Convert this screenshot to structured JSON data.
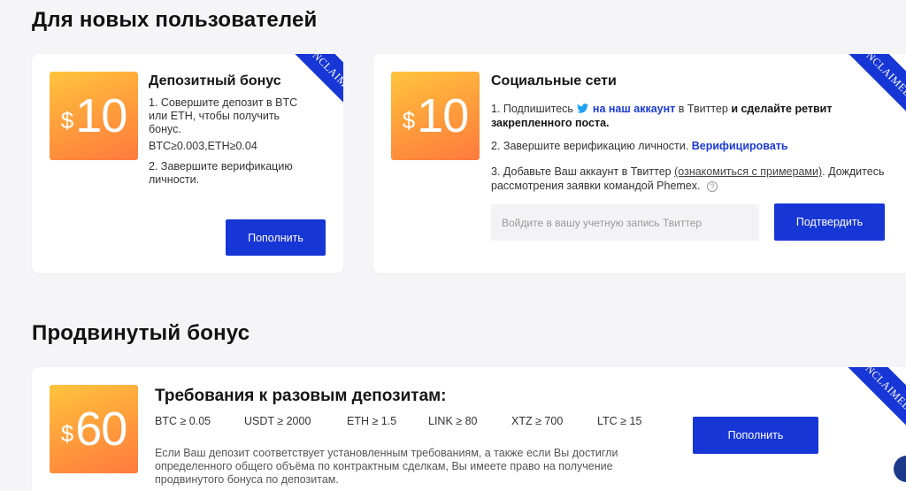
{
  "sections": {
    "new_users_title": "Для новых пользователей",
    "advanced_title": "Продвинутый бонус"
  },
  "ribbon_label": "UNCLAIMED",
  "deposit_card": {
    "badge_dollar": "$",
    "badge_amount": "10",
    "title": "Депозитный бонус",
    "step1": "1. Совершите депозит в BTC или ETH, чтобы получить бонус.",
    "requirement": "BTC≥0.003,ETH≥0.04",
    "step2": "2. Завершите верификацию личности.",
    "button_label": "Пополнить"
  },
  "social_card": {
    "badge_dollar": "$",
    "badge_amount": "10",
    "title": "Социальные сети",
    "step1_prefix": "1. Подпишитесь",
    "step1_link": "на наш аккаунт",
    "step1_mid": "в Твиттер",
    "step1_bold": "и сделайте ретвит закрепленного поста.",
    "step2_prefix": "2. Завершите верификацию личности.",
    "step2_link": "Верифицировать",
    "step3_prefix": "3. Добавьте Ваш аккаунт в Твиттер",
    "step3_link": "(ознакомиться с примерами)",
    "step3_suffix": ". Дождитесь рассмотрения заявки командой Phemex.",
    "input_placeholder": "Войдите в вашу учетную запись Твиттер",
    "button_label": "Подтвердить"
  },
  "advanced_card": {
    "badge_dollar": "$",
    "badge_amount": "60",
    "title": "Требования к разовым депозитам:",
    "requirements": [
      "BTC ≥ 0.05",
      "USDT ≥ 2000",
      "ETH ≥ 1.5",
      "LINK ≥ 80",
      "XTZ ≥ 700",
      "LTC ≥ 15"
    ],
    "description": "Если Ваш депозит соответствует установленным требованиям, а также если Вы достигли определенного общего объёма по контрактным сделкам, Вы имеете право на получение продвинутого бонуса по депозитам.",
    "button_label": "Пополнить"
  },
  "colors": {
    "accent": "#1736d6",
    "badge_start": "#ffc43d",
    "badge_end": "#ff7a3d",
    "background": "#f5f5f7"
  }
}
